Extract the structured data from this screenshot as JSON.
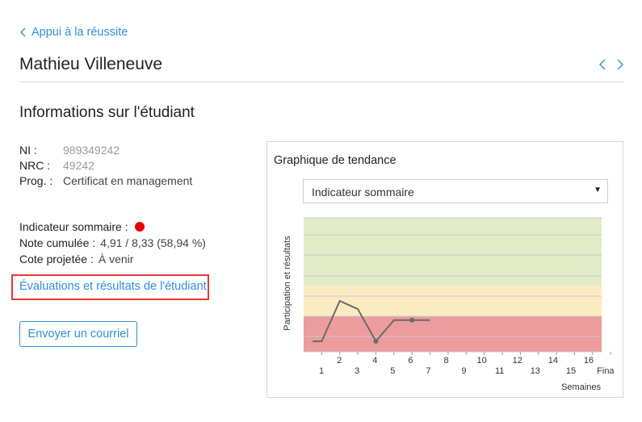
{
  "header": {
    "back_label": "Appui à la réussite",
    "student_name": "Mathieu Villeneuve"
  },
  "section": {
    "title": "Informations sur l'étudiant"
  },
  "info": [
    {
      "label": "NI :",
      "value": "989349242"
    },
    {
      "label": "NRC :",
      "value": "49242"
    },
    {
      "label": "Prog. :",
      "value": "Certificat en management"
    }
  ],
  "summary": {
    "indicator_label": "Indicateur sommaire :",
    "indicator_status_color": "#e60000",
    "cumulative_label": "Note cumulée :",
    "cumulative_value": "4,91 / 8,33 (58,94 %)",
    "projected_label": "Cote projetée :",
    "projected_value": "À venir"
  },
  "links": {
    "evaluations": "Évaluations et résultats de l'étudiant"
  },
  "buttons": {
    "email": "Envoyer un courriel"
  },
  "trend": {
    "title": "Graphique de tendance",
    "select_value": "Indicateur sommaire"
  },
  "chart_data": {
    "type": "line",
    "ylabel": "Participation et résultats",
    "xlabel": "Semaines",
    "x_tick_labels": [
      "1",
      "2",
      "3",
      "4",
      "5",
      "6",
      "7",
      "8",
      "9",
      "10",
      "11",
      "12",
      "13",
      "14",
      "15",
      "16",
      "Final"
    ],
    "zones": [
      {
        "name": "red",
        "color": "#ec9c9c"
      },
      {
        "name": "yellow",
        "color": "#fcebc0"
      },
      {
        "name": "green",
        "color": "#e2ecc8"
      }
    ],
    "series": [
      {
        "color": "#6b6b6b",
        "x": [
          0.5,
          1,
          2,
          3,
          4,
          5,
          6,
          7
        ],
        "y": [
          0,
          0,
          2.0,
          1.6,
          0,
          1.05,
          1.05,
          1.05
        ],
        "markers_at": [
          4,
          6
        ]
      }
    ]
  }
}
